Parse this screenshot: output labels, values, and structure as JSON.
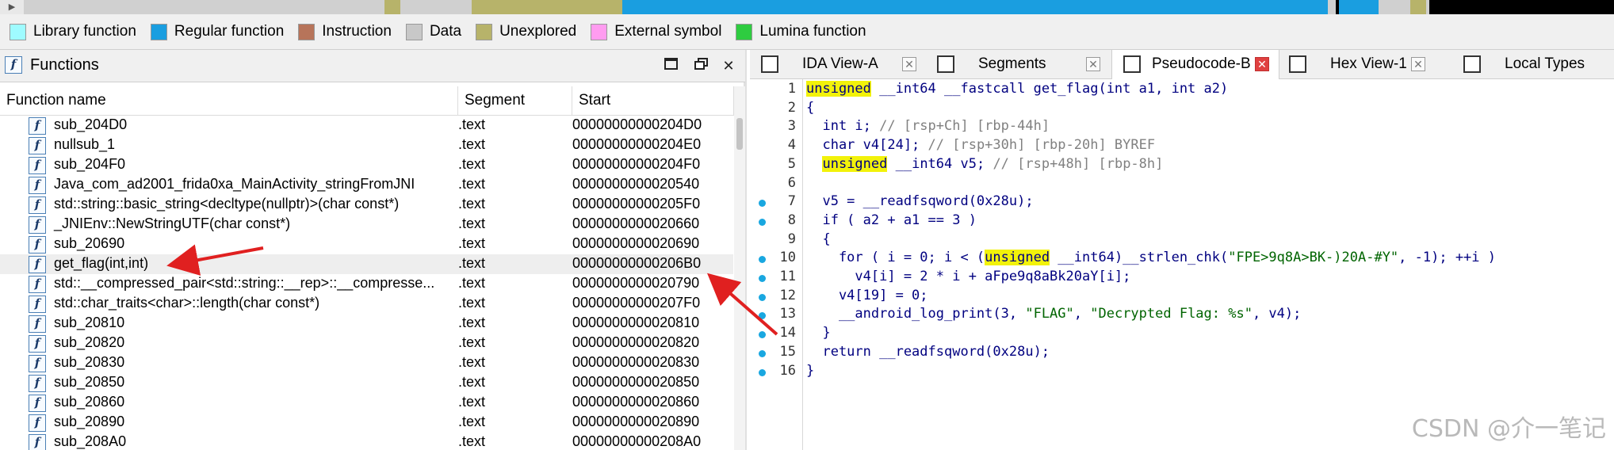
{
  "legend": [
    {
      "label": "Library function",
      "color": "#9ffbff"
    },
    {
      "label": "Regular function",
      "color": "#1a9ee0"
    },
    {
      "label": "Instruction",
      "color": "#b7745a"
    },
    {
      "label": "Data",
      "color": "#c8c8c8"
    },
    {
      "label": "Unexplored",
      "color": "#b7b36a"
    },
    {
      "label": "External symbol",
      "color": "#ff9cf0"
    },
    {
      "label": "Lumina function",
      "color": "#2ecc40"
    }
  ],
  "functions_panel": {
    "title": "Functions",
    "columns": [
      "Function name",
      "Segment",
      "Start"
    ],
    "rows": [
      {
        "name": "sub_204D0",
        "segment": ".text",
        "start": "00000000000204D0"
      },
      {
        "name": "nullsub_1",
        "segment": ".text",
        "start": "00000000000204E0"
      },
      {
        "name": "sub_204F0",
        "segment": ".text",
        "start": "00000000000204F0"
      },
      {
        "name": "Java_com_ad2001_frida0xa_MainActivity_stringFromJNI",
        "segment": ".text",
        "start": "0000000000020540"
      },
      {
        "name": "std::string::basic_string<decltype(nullptr)>(char const*)",
        "segment": ".text",
        "start": "00000000000205F0"
      },
      {
        "name": "_JNIEnv::NewStringUTF(char const*)",
        "segment": ".text",
        "start": "0000000000020660"
      },
      {
        "name": "sub_20690",
        "segment": ".text",
        "start": "0000000000020690"
      },
      {
        "name": "get_flag(int,int)",
        "segment": ".text",
        "start": "00000000000206B0"
      },
      {
        "name": "std::__compressed_pair<std::string::__rep>::__compresse...",
        "segment": ".text",
        "start": "0000000000020790"
      },
      {
        "name": "std::char_traits<char>::length(char const*)",
        "segment": ".text",
        "start": "00000000000207F0"
      },
      {
        "name": "sub_20810",
        "segment": ".text",
        "start": "0000000000020810"
      },
      {
        "name": "sub_20820",
        "segment": ".text",
        "start": "0000000000020820"
      },
      {
        "name": "sub_20830",
        "segment": ".text",
        "start": "0000000000020830"
      },
      {
        "name": "sub_20850",
        "segment": ".text",
        "start": "0000000000020850"
      },
      {
        "name": "sub_20860",
        "segment": ".text",
        "start": "0000000000020860"
      },
      {
        "name": "sub_20890",
        "segment": ".text",
        "start": "0000000000020890"
      },
      {
        "name": "sub_208A0",
        "segment": ".text",
        "start": "00000000000208A0"
      }
    ]
  },
  "tabs": [
    {
      "label": "IDA View-A",
      "icon": "graph-view-icon",
      "active": false
    },
    {
      "label": "Segments",
      "icon": "segments-icon",
      "active": false
    },
    {
      "label": "Pseudocode-B",
      "icon": "pseudocode-icon",
      "active": true
    },
    {
      "label": "Hex View-1",
      "icon": "hex-view-icon",
      "active": false
    },
    {
      "label": "Local Types",
      "icon": "local-types-icon",
      "active": false
    }
  ],
  "code": {
    "line_numbers": [
      "1",
      "2",
      "3",
      "4",
      "5",
      "6",
      "7",
      "8",
      "9",
      "10",
      "11",
      "12",
      "13",
      "14",
      "15",
      "16"
    ],
    "lines": [
      [
        [
          "hl",
          "unsigned"
        ],
        [
          "kw",
          " __int64 __fastcall get_flag(int a1, int a2)"
        ]
      ],
      [
        [
          "kw",
          "{"
        ]
      ],
      [
        [
          "kw",
          "  int i; "
        ],
        [
          "cm",
          "// [rsp+Ch] [rbp-44h]"
        ]
      ],
      [
        [
          "kw",
          "  char v4[24]; "
        ],
        [
          "cm",
          "// [rsp+30h] [rbp-20h] BYREF"
        ]
      ],
      [
        [
          "kw",
          "  "
        ],
        [
          "hl",
          "unsigned"
        ],
        [
          "kw",
          " __int64 v5; "
        ],
        [
          "cm",
          "// [rsp+48h] [rbp-8h]"
        ]
      ],
      [
        [
          "kw",
          ""
        ]
      ],
      [
        [
          "kw",
          "  v5 = __readfsqword(0x28u);"
        ]
      ],
      [
        [
          "kw",
          "  if ( a2 + a1 == 3 )"
        ]
      ],
      [
        [
          "kw",
          "  {"
        ]
      ],
      [
        [
          "kw",
          "    for ( i = 0; i < ("
        ],
        [
          "hl",
          "unsigned"
        ],
        [
          "kw",
          " __int64)__strlen_chk("
        ],
        [
          "st",
          "\"FPE>9q8A>BK-)20A-#Y\""
        ],
        [
          "kw",
          ", -1); ++i )"
        ]
      ],
      [
        [
          "kw",
          "      v4[i] = 2 * i + aFpe9q8aBk20aY[i];"
        ]
      ],
      [
        [
          "kw",
          "    v4[19] = 0;"
        ]
      ],
      [
        [
          "kw",
          "    __android_log_print(3, "
        ],
        [
          "st",
          "\"FLAG\""
        ],
        [
          "kw",
          ", "
        ],
        [
          "st",
          "\"Decrypted Flag: %s\""
        ],
        [
          "kw",
          ", v4);"
        ]
      ],
      [
        [
          "kw",
          "  }"
        ]
      ],
      [
        [
          "kw",
          "  return __readfsqword(0x28u);"
        ]
      ],
      [
        [
          "kw",
          "}"
        ]
      ]
    ],
    "breakpoint_lines": [
      "7",
      "8",
      "10",
      "11",
      "12",
      "13",
      "14",
      "15",
      "16"
    ]
  },
  "watermark": "CSDN @介一笔记"
}
